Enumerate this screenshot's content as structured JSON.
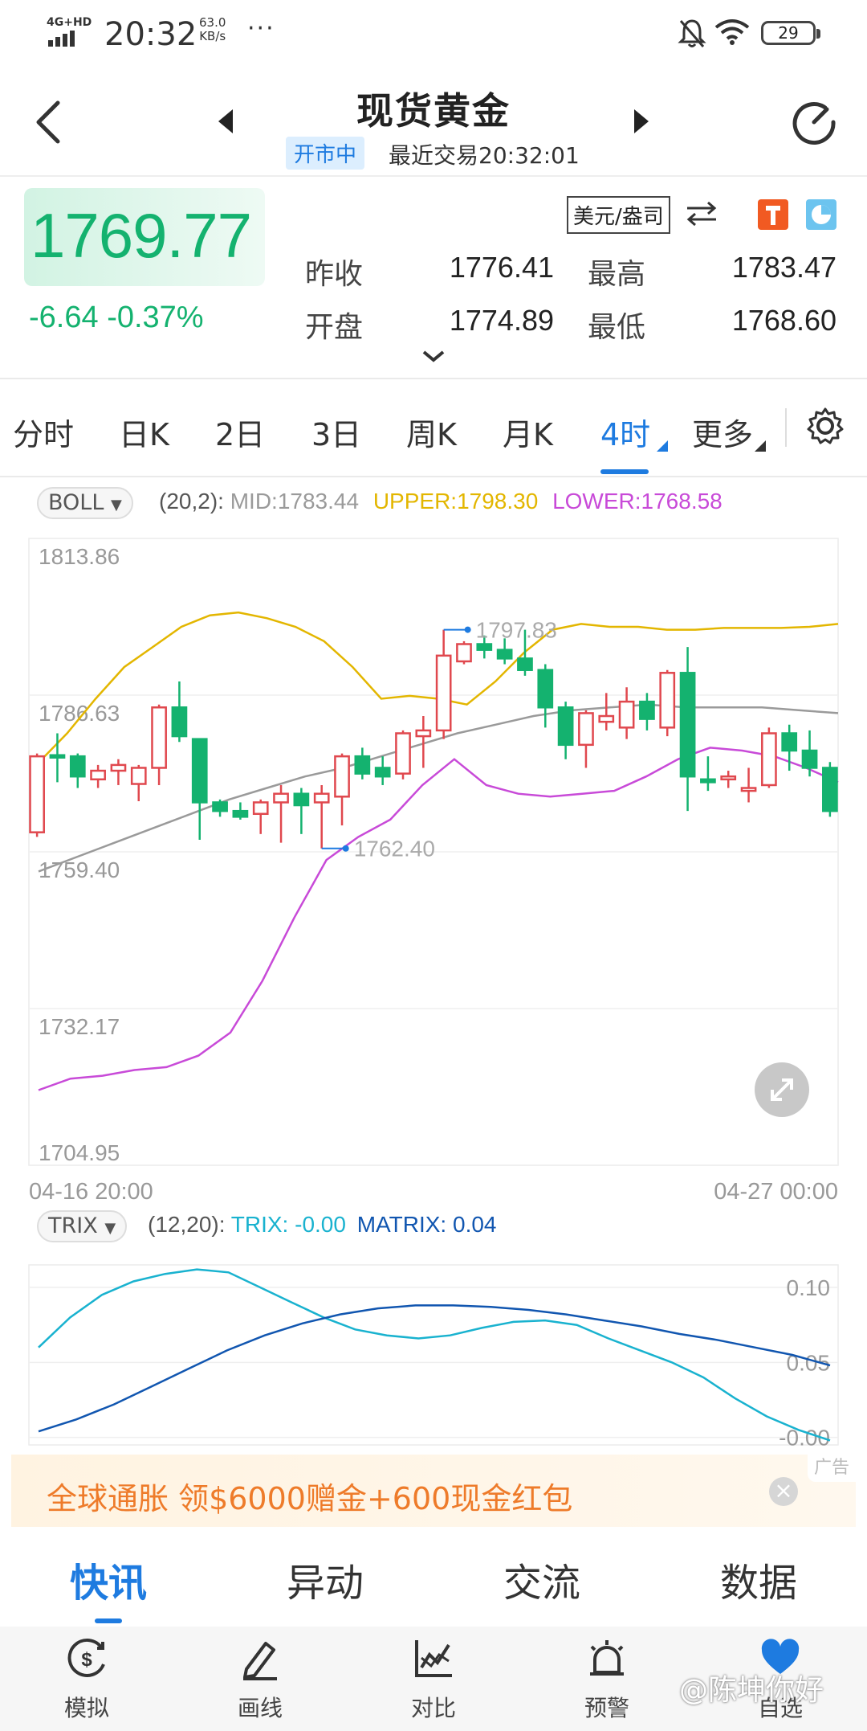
{
  "status_bar": {
    "network": "4G+HD",
    "time": "20:32",
    "speed_value": "63.0",
    "speed_unit": "KB/s",
    "more": "···",
    "battery": "29"
  },
  "header": {
    "title": "现货黄金",
    "market_status": "开市中",
    "last_trade": "最近交易20:32:01"
  },
  "quote": {
    "price": "1769.77",
    "change": "-6.64",
    "change_pct": "-0.37%",
    "unit": "美元/盎司",
    "prev_close_label": "昨收",
    "prev_close": "1776.41",
    "high_label": "最高",
    "high": "1783.47",
    "open_label": "开盘",
    "open": "1774.89",
    "low_label": "最低",
    "low": "1768.60"
  },
  "period_tabs": [
    "分时",
    "日K",
    "2日",
    "3日",
    "周K",
    "月K",
    "4时",
    "更多"
  ],
  "active_period": "4时",
  "main_indicator": {
    "name": "BOLL",
    "params": "(20,2):",
    "mid": "MID:1783.44",
    "upper": "UPPER:1798.30",
    "lower": "LOWER:1768.58"
  },
  "sub_indicator": {
    "name": "TRIX",
    "params": "(12,20):",
    "trix": "TRIX: -0.00",
    "matrix": "MATRIX: 0.04"
  },
  "colors": {
    "up": "#e0484e",
    "down": "#14b26f",
    "accent": "#1e7be0",
    "upper": "#e3b600",
    "lower": "#c84ad8",
    "mid": "#9a9a9a",
    "trix": "#19b2cf",
    "matrix": "#1156b0"
  },
  "chart_data": [
    {
      "type": "candlestick",
      "y_axis_labels": [
        "1813.86",
        "1786.63",
        "1759.40",
        "1732.17",
        "1704.95"
      ],
      "ylim": [
        1704.95,
        1813.86
      ],
      "x_labels": [
        "04-16 20:00",
        "04-27 00:00"
      ],
      "annotations": [
        {
          "label": "1797.83"
        },
        {
          "label": "1762.40"
        }
      ],
      "candles": [
        {
          "o": 1762.8,
          "h": 1776.5,
          "l": 1762.0,
          "c": 1776.0
        },
        {
          "o": 1776.2,
          "h": 1780.0,
          "l": 1771.5,
          "c": 1776.0
        },
        {
          "o": 1776.0,
          "h": 1776.5,
          "l": 1770.5,
          "c": 1772.5
        },
        {
          "o": 1772.0,
          "h": 1774.5,
          "l": 1770.5,
          "c": 1773.5
        },
        {
          "o": 1773.5,
          "h": 1775.5,
          "l": 1771.0,
          "c": 1774.5
        },
        {
          "o": 1771.2,
          "h": 1774.5,
          "l": 1768.2,
          "c": 1774.0
        },
        {
          "o": 1774.0,
          "h": 1785.0,
          "l": 1771.0,
          "c": 1784.5
        },
        {
          "o": 1784.5,
          "h": 1789.0,
          "l": 1778.5,
          "c": 1779.5
        },
        {
          "o": 1779.0,
          "h": 1779.0,
          "l": 1761.5,
          "c": 1768.0
        },
        {
          "o": 1768.0,
          "h": 1768.5,
          "l": 1765.5,
          "c": 1766.5
        },
        {
          "o": 1766.5,
          "h": 1768.0,
          "l": 1765.0,
          "c": 1765.5
        },
        {
          "o": 1766.0,
          "h": 1768.5,
          "l": 1762.5,
          "c": 1768.0
        },
        {
          "o": 1768.0,
          "h": 1771.0,
          "l": 1761.0,
          "c": 1769.5
        },
        {
          "o": 1769.5,
          "h": 1770.5,
          "l": 1762.5,
          "c": 1767.5
        },
        {
          "o": 1768.0,
          "h": 1771.0,
          "l": 1760.0,
          "c": 1769.5
        },
        {
          "o": 1769.0,
          "h": 1776.5,
          "l": 1764.0,
          "c": 1776.0
        },
        {
          "o": 1776.0,
          "h": 1777.5,
          "l": 1772.0,
          "c": 1773.0
        },
        {
          "o": 1774.0,
          "h": 1776.0,
          "l": 1771.0,
          "c": 1772.5
        },
        {
          "o": 1773.0,
          "h": 1780.5,
          "l": 1772.0,
          "c": 1780.0
        },
        {
          "o": 1779.5,
          "h": 1783.0,
          "l": 1774.0,
          "c": 1780.5
        },
        {
          "o": 1780.5,
          "h": 1798.0,
          "l": 1779.0,
          "c": 1793.5
        },
        {
          "o": 1792.5,
          "h": 1796.0,
          "l": 1792.0,
          "c": 1795.5
        },
        {
          "o": 1795.5,
          "h": 1797.0,
          "l": 1793.0,
          "c": 1794.5
        },
        {
          "o": 1794.5,
          "h": 1796.5,
          "l": 1792.0,
          "c": 1793.0
        },
        {
          "o": 1793.0,
          "h": 1798.0,
          "l": 1790.0,
          "c": 1791.0
        },
        {
          "o": 1791.0,
          "h": 1792.0,
          "l": 1781.0,
          "c": 1784.5
        },
        {
          "o": 1784.5,
          "h": 1785.5,
          "l": 1775.5,
          "c": 1778.0
        },
        {
          "o": 1778.0,
          "h": 1784.0,
          "l": 1774.0,
          "c": 1783.5
        },
        {
          "o": 1782.0,
          "h": 1787.0,
          "l": 1780.5,
          "c": 1783.0
        },
        {
          "o": 1781.0,
          "h": 1788.0,
          "l": 1779.0,
          "c": 1785.5
        },
        {
          "o": 1785.5,
          "h": 1787.0,
          "l": 1780.5,
          "c": 1782.5
        },
        {
          "o": 1781.0,
          "h": 1791.0,
          "l": 1779.5,
          "c": 1790.5
        },
        {
          "o": 1790.5,
          "h": 1795.0,
          "l": 1766.5,
          "c": 1772.5
        },
        {
          "o": 1772.0,
          "h": 1776.0,
          "l": 1770.0,
          "c": 1771.5
        },
        {
          "o": 1772.0,
          "h": 1773.5,
          "l": 1770.5,
          "c": 1772.5
        },
        {
          "o": 1770.0,
          "h": 1774.0,
          "l": 1768.0,
          "c": 1770.5
        },
        {
          "o": 1771.0,
          "h": 1781.0,
          "l": 1770.5,
          "c": 1780.0
        },
        {
          "o": 1780.0,
          "h": 1781.5,
          "l": 1773.5,
          "c": 1777.0
        },
        {
          "o": 1777.0,
          "h": 1780.5,
          "l": 1772.5,
          "c": 1774.0
        },
        {
          "o": 1774.0,
          "h": 1775.0,
          "l": 1765.5,
          "c": 1766.5
        }
      ],
      "series": [
        {
          "values": [
            1774.9,
            1780.0,
            1786.0,
            1791.5,
            1795.0,
            1798.5,
            1800.5,
            1801.0,
            1800.0,
            1798.5,
            1796.0,
            1791.5,
            1786.0,
            1786.5,
            1786.0,
            1785.0,
            1789.0,
            1794.0,
            1798.0,
            1799.0,
            1798.5,
            1798.5,
            1798.0,
            1798.0,
            1798.3,
            1798.3,
            1798.3,
            1798.5,
            1799.0
          ]
        },
        {
          "values": [
            1756.0,
            1758.5,
            1761.0,
            1763.5,
            1766.0,
            1768.5,
            1770.5,
            1772.5,
            1774.0,
            1776.0,
            1778.0,
            1780.0,
            1781.5,
            1783.0,
            1784.0,
            1784.5,
            1785.0,
            1784.5,
            1784.5,
            1784.5,
            1784.0,
            1783.5
          ]
        },
        {
          "values": [
            1718.0,
            1720.0,
            1720.5,
            1721.5,
            1722.0,
            1724.0,
            1728.0,
            1737.0,
            1748.0,
            1758.0,
            1762.0,
            1765.0,
            1771.0,
            1775.5,
            1771.0,
            1769.5,
            1769.0,
            1769.5,
            1770.0,
            1772.5,
            1775.5,
            1777.5,
            1777.0,
            1776.0,
            1774.0,
            1771.5
          ]
        }
      ]
    },
    {
      "type": "line",
      "y_axis_labels": [
        "0.10",
        "0.05",
        "-0.00"
      ],
      "series": [
        {
          "values": [
            0.06,
            0.08,
            0.095,
            0.104,
            0.109,
            0.112,
            0.11,
            0.1,
            0.09,
            0.08,
            0.072,
            0.068,
            0.066,
            0.068,
            0.073,
            0.077,
            0.078,
            0.075,
            0.066,
            0.058,
            0.05,
            0.04,
            0.026,
            0.014,
            0.005,
            -0.002
          ]
        },
        {
          "values": [
            0.004,
            0.012,
            0.022,
            0.034,
            0.046,
            0.058,
            0.068,
            0.076,
            0.082,
            0.086,
            0.088,
            0.088,
            0.087,
            0.085,
            0.082,
            0.078,
            0.074,
            0.069,
            0.065,
            0.06,
            0.055,
            0.048
          ]
        }
      ]
    }
  ],
  "expand_icon": "expand-icon",
  "ad": {
    "text": "全球通胀 领$6000赠金+600现金红包",
    "tag": "广告",
    "close": "×"
  },
  "news_tabs": [
    "快讯",
    "异动",
    "交流",
    "数据"
  ],
  "bottom_nav": [
    "模拟",
    "画线",
    "对比",
    "预警",
    "自选"
  ],
  "watermark": "@陈坤你好"
}
